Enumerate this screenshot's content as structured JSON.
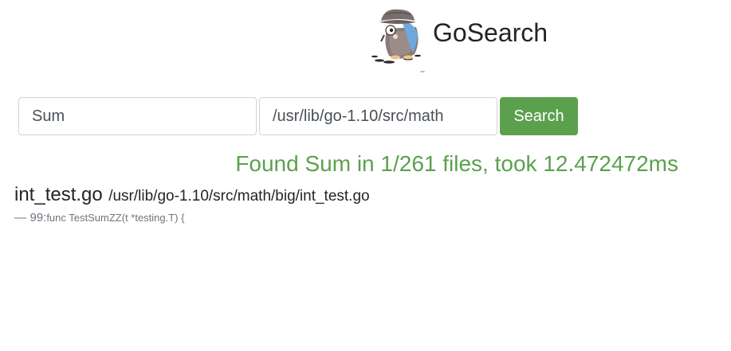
{
  "app": {
    "title": "GoSearch",
    "logo_icon": "gopher-detective-icon"
  },
  "search": {
    "query_value": "Sum",
    "path_value": "/usr/lib/go-1.10/src/math",
    "button_label": "Search"
  },
  "summary": {
    "text": "Found Sum in 1/261 files, took 12.472472ms",
    "color": "#5ba14d"
  },
  "results": [
    {
      "file": "int_test.go",
      "path": "/usr/lib/go-1.10/src/math/big/int_test.go",
      "matches": [
        {
          "dash": "—",
          "line_prefix": "99:",
          "code": "func TestSumZZ(t *testing.T) {"
        }
      ]
    }
  ],
  "colors": {
    "accent": "#5ba14d",
    "text": "#212529",
    "muted": "#6c757d",
    "border": "#ced4da"
  }
}
